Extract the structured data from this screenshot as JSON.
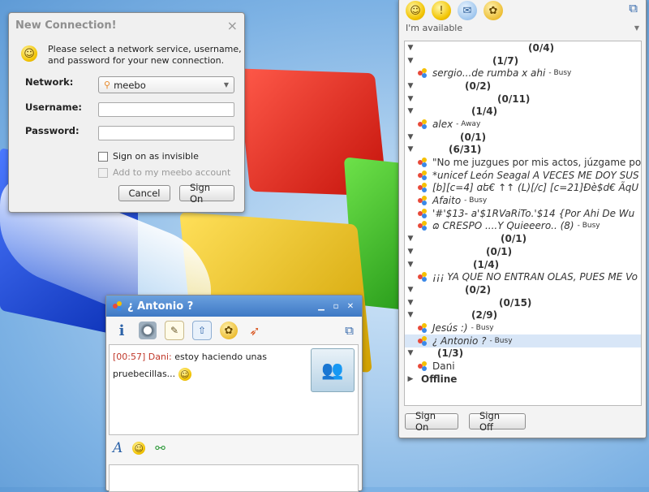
{
  "dialog": {
    "title": "New Connection!",
    "close_glyph": "×",
    "description_line1": "Please select a network service, username,",
    "description_line2": "and password for your new connection.",
    "network_label": "Network:",
    "network_value": "meebo",
    "username_label": "Username:",
    "username_value": "",
    "password_label": "Password:",
    "password_value": "",
    "invisible_label": "Sign on as invisible",
    "add_account_label": "Add to my meebo account",
    "cancel_label": "Cancel",
    "signon_label": "Sign On"
  },
  "contact_list": {
    "status_text": "I'm available",
    "rows": [
      {
        "kind": "group",
        "text": "(0/4)",
        "indent": 138
      },
      {
        "kind": "group",
        "text": "(1/7)",
        "indent": 94
      },
      {
        "kind": "contact",
        "name": "sergio...de rumba x ahi",
        "status": "- Busy"
      },
      {
        "kind": "group",
        "text": "(0/2)",
        "indent": 60
      },
      {
        "kind": "group",
        "text": "(0/11)",
        "indent": 100
      },
      {
        "kind": "group",
        "text": "(1/4)",
        "indent": 68
      },
      {
        "kind": "contact",
        "name": "alex",
        "status": "- Away"
      },
      {
        "kind": "group",
        "text": "(0/1)",
        "indent": 54
      },
      {
        "kind": "group",
        "text": "(6/31)",
        "indent": 40
      },
      {
        "kind": "contact",
        "name": "\"No me juzgues por mis actos, júzgame por",
        "status": "",
        "plain": true
      },
      {
        "kind": "contact",
        "name": "*unicef León Seagal A VECES ME DOY SUS",
        "status": ""
      },
      {
        "kind": "contact",
        "name": "[b][c=4] ɑե€ ↑↑ (L)[/c] [c=21]Ðè$d€ ÃqU",
        "status": ""
      },
      {
        "kind": "contact",
        "name": "Afaito",
        "status": "- Busy"
      },
      {
        "kind": "contact",
        "name": "'#'$13- a'$1RVaRiTo.'$14 {Por Ahi De Wu",
        "status": ""
      },
      {
        "kind": "contact",
        "name": "ɷ CRESPO ....Y Quieeero.. (8)",
        "status": "- Busy"
      },
      {
        "kind": "group",
        "text": "(0/1)",
        "indent": 104
      },
      {
        "kind": "group",
        "text": "(0/1)",
        "indent": 86
      },
      {
        "kind": "group",
        "text": "(1/4)",
        "indent": 70
      },
      {
        "kind": "contact",
        "name": "¡¡¡ YA QUE NO ENTRAN OLAS, PUES ME Vo",
        "status": ""
      },
      {
        "kind": "group",
        "text": "(0/2)",
        "indent": 60
      },
      {
        "kind": "group",
        "text": "(0/15)",
        "indent": 102
      },
      {
        "kind": "group",
        "text": "(2/9)",
        "indent": 68
      },
      {
        "kind": "contact",
        "name": "Jesús :)",
        "status": "- Busy"
      },
      {
        "kind": "contact",
        "name": "¿ Antonio ?",
        "status": "- Busy",
        "selected": true
      },
      {
        "kind": "group",
        "text": "(1/3)",
        "indent": 26
      },
      {
        "kind": "contact",
        "name": "Dani",
        "status": "",
        "plain": true
      },
      {
        "kind": "group",
        "text": "Offline",
        "indent": 6,
        "collapsed": true
      }
    ],
    "signon_label": "Sign On",
    "signoff_label": "Sign Off"
  },
  "chat": {
    "title": "¿ Antonio ?",
    "message_time": "[00:57]",
    "message_sender": "Dani:",
    "message_text_1": "estoy haciendo unas",
    "message_text_2": "pruebecillas...",
    "format_italic_glyph": "A"
  },
  "colors": {
    "accent_blue": "#3e79c5",
    "timestamp_color": "#c0392b",
    "status_busy": "#333333"
  }
}
